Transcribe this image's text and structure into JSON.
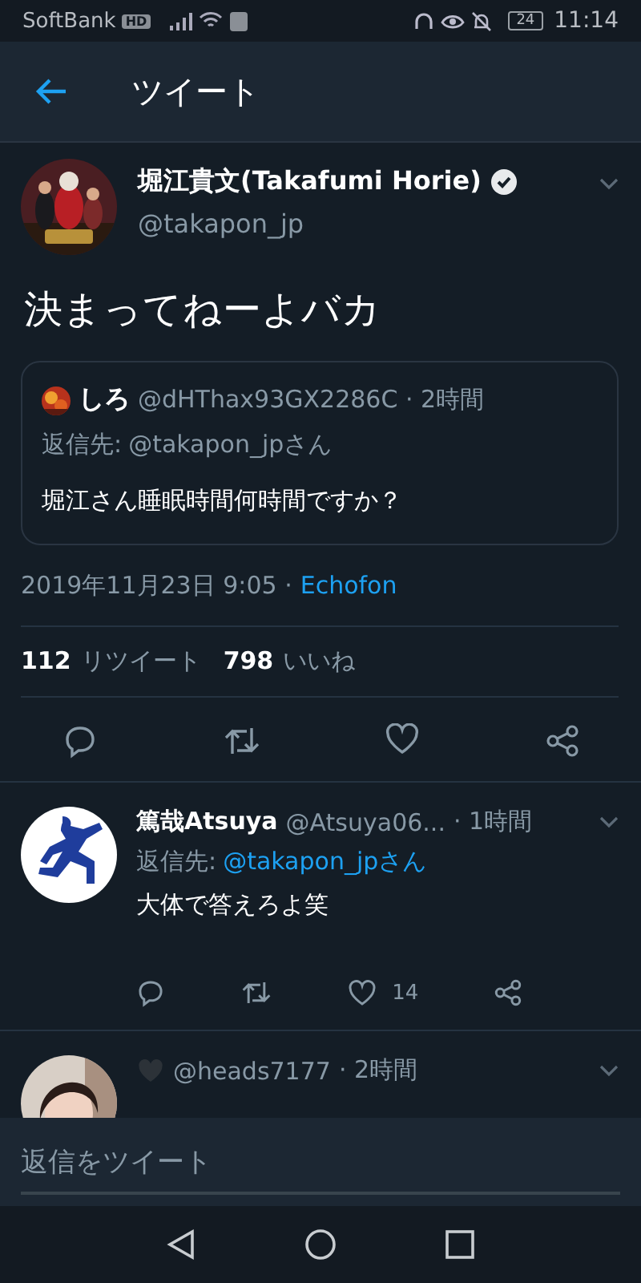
{
  "status_bar": {
    "carrier": "SoftBank",
    "network_badge": "HD",
    "battery": "24",
    "time": "11:14"
  },
  "header": {
    "title": "ツイート"
  },
  "tweet": {
    "name": "堀江貴文(Takafumi Horie)",
    "verified": true,
    "handle": "@takapon_jp",
    "text": "決まってねーよバカ",
    "quote": {
      "name": "しろ",
      "handle_time": "@dHThax93GX2286C · 2時間",
      "reply_label": "返信先:",
      "reply_to": "@takapon_jpさん",
      "text": "堀江さん睡眠時間何時間ですか？"
    },
    "date": "2019年11月23日 9:05 ·",
    "source": "Echofon",
    "stats": [
      {
        "count": "112",
        "label": "リツイート"
      },
      {
        "count": "798",
        "label": "いいね"
      }
    ]
  },
  "replies": [
    {
      "name": "篤哉Atsuya",
      "handle": "@Atsuya06...",
      "time": "· 1時間",
      "reply_label": "返信先:",
      "reply_to": "@takapon_jpさん",
      "text": "大体で答えろよ笑",
      "like_count": "14",
      "kind": "logo"
    },
    {
      "handle": "@heads7177",
      "time": "· 2時間",
      "kind": "picture"
    }
  ],
  "compose": {
    "placeholder": "返信をツイート"
  }
}
